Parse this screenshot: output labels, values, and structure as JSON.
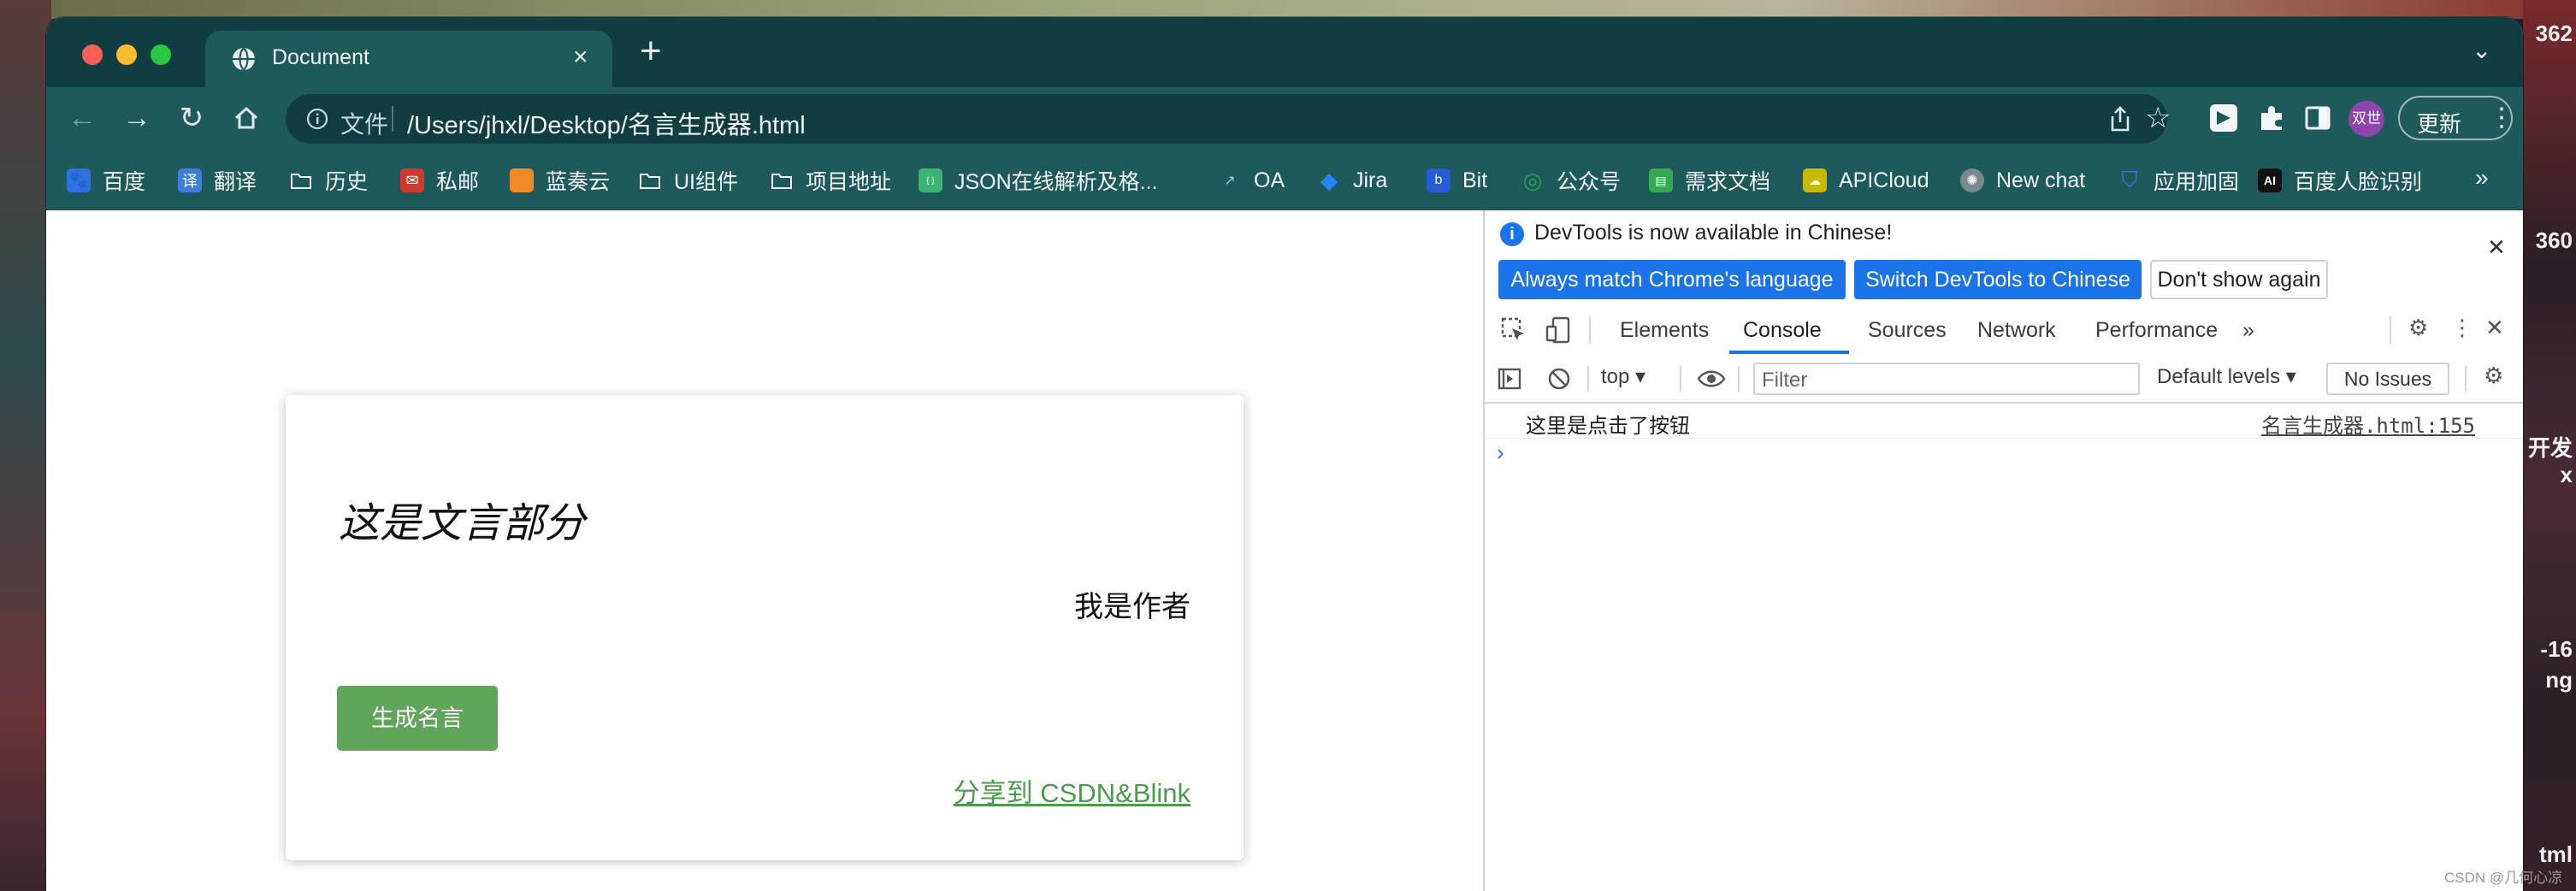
{
  "desktop": {
    "right_edge_texts": [
      "362",
      "360",
      "开发",
      "x",
      "-16",
      "ng",
      "tml"
    ]
  },
  "browser": {
    "tab": {
      "title": "Document",
      "icon": "globe-icon"
    },
    "new_tab_label": "+",
    "address": {
      "scheme_label": "文件",
      "url": "/Users/jhxl/Desktop/名言生成器.html"
    },
    "avatar_label": "双世",
    "update_button": "更新",
    "bookmarks": [
      {
        "label": "百度",
        "icon": "baidu-icon",
        "color": "#2f6fe4",
        "glyph": ""
      },
      {
        "label": "翻译",
        "icon": "translate-icon",
        "color": "#3b7ddd",
        "glyph": "译"
      },
      {
        "label": "历史",
        "icon": "folder-icon",
        "color": "",
        "glyph": ""
      },
      {
        "label": "私邮",
        "icon": "mail-icon",
        "color": "#d33a2f",
        "glyph": ""
      },
      {
        "label": "蓝奏云",
        "icon": "lanzou-icon",
        "color": "#f08a24",
        "glyph": ""
      },
      {
        "label": "UI组件",
        "icon": "folder-icon",
        "color": "",
        "glyph": ""
      },
      {
        "label": "项目地址",
        "icon": "folder-icon",
        "color": "",
        "glyph": ""
      },
      {
        "label": "JSON在线解析及格...",
        "icon": "json-icon",
        "color": "#3cb371",
        "glyph": ""
      },
      {
        "label": "OA",
        "icon": "oa-icon",
        "color": "",
        "glyph": ""
      },
      {
        "label": "Jira",
        "icon": "jira-icon",
        "color": "#2684ff",
        "glyph": ""
      },
      {
        "label": "Bit",
        "icon": "bit-icon",
        "color": "#2a5bd7",
        "glyph": ""
      },
      {
        "label": "公众号",
        "icon": "wechat-official-icon",
        "color": "#2ba24c",
        "glyph": ""
      },
      {
        "label": "需求文档",
        "icon": "sheet-icon",
        "color": "#34a853",
        "glyph": ""
      },
      {
        "label": "APICloud",
        "icon": "apicloud-icon",
        "color": "#c9b800",
        "glyph": ""
      },
      {
        "label": "New chat",
        "icon": "openai-icon",
        "color": "#7a8a8a",
        "glyph": ""
      },
      {
        "label": "应用加固",
        "icon": "shield-icon",
        "color": "#3a6fd8",
        "glyph": ""
      },
      {
        "label": "百度人脸识别",
        "icon": "ai-icon",
        "color": "#111111",
        "glyph": "AI"
      }
    ],
    "bookmarks_overflow": "»"
  },
  "page": {
    "quote": "这是文言部分",
    "author": "我是作者",
    "generate_button": "生成名言",
    "share_link": "分享到 CSDN&Blink",
    "accent_color": "#5fa55a"
  },
  "devtools": {
    "infobar": {
      "message": "DevTools is now available in Chinese!",
      "buttons": [
        "Always match Chrome's language",
        "Switch DevTools to Chinese",
        "Don't show again"
      ]
    },
    "tabs": [
      "Elements",
      "Console",
      "Sources",
      "Network",
      "Performance"
    ],
    "active_tab": "Console",
    "tabs_overflow": "»",
    "console": {
      "context": "top",
      "filter_placeholder": "Filter",
      "levels": "Default levels",
      "issues": "No Issues",
      "logs": [
        {
          "message": "这里是点击了按钮",
          "source": "名言生成器.html:155"
        }
      ],
      "prompt": "›"
    }
  },
  "watermark": "CSDN @几何心凉"
}
